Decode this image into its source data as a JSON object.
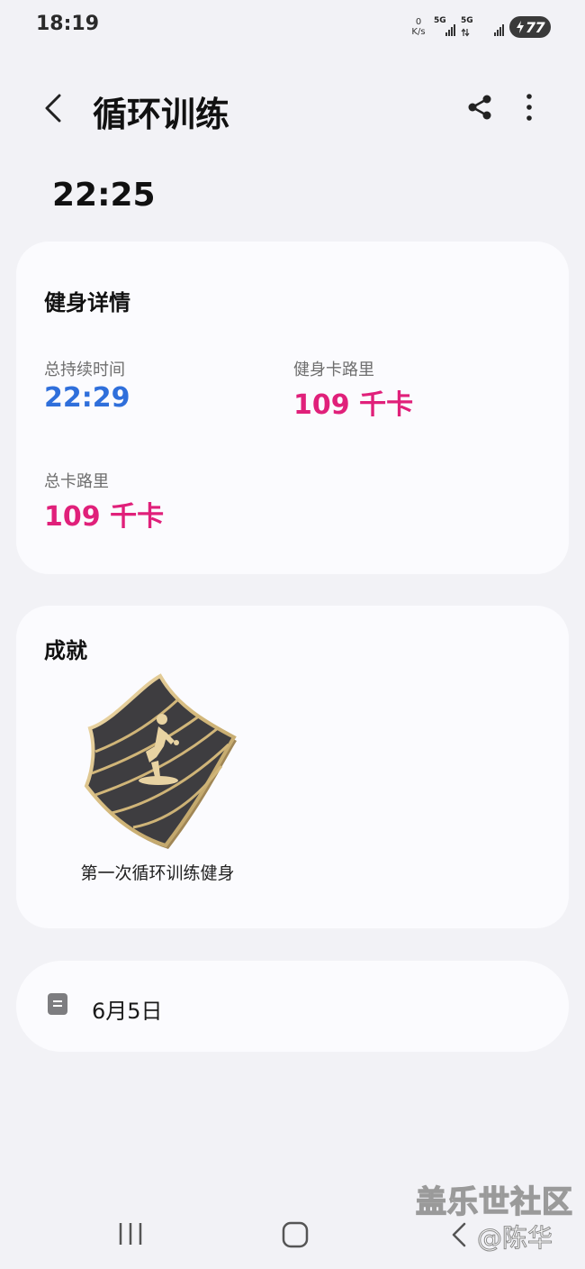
{
  "status_bar": {
    "time": "18:19",
    "net_speed_value": "0",
    "net_speed_unit": "K/s",
    "sim1_label": "5G",
    "sim2_label": "5G",
    "battery_level": "77"
  },
  "header": {
    "title": "循环训练",
    "back_icon": "chevron-left-icon",
    "share_icon": "share-icon",
    "more_icon": "more-vertical-icon"
  },
  "workout": {
    "start_time": "22:25"
  },
  "details": {
    "title": "健身详情",
    "metrics": [
      {
        "label": "总持续时间",
        "value": "22:29",
        "color": "#2f6fdb"
      },
      {
        "label": "健身卡路里",
        "value": "109 千卡",
        "color": "#e0207a"
      },
      {
        "label": "总卡路里",
        "value": "109 千卡",
        "color": "#e0207a"
      }
    ]
  },
  "achievements": {
    "title": "成就",
    "badges": [
      {
        "name": "第一次循环训练健身",
        "icon": "circuit-training-badge-icon"
      }
    ]
  },
  "note": {
    "icon": "note-icon",
    "date": "6月5日"
  },
  "watermark": {
    "site": "盖乐世社区",
    "user": "@陈华"
  },
  "nav_bar": {
    "recent_icon": "recent-apps-icon",
    "home_icon": "home-icon",
    "back_icon": "back-icon"
  }
}
